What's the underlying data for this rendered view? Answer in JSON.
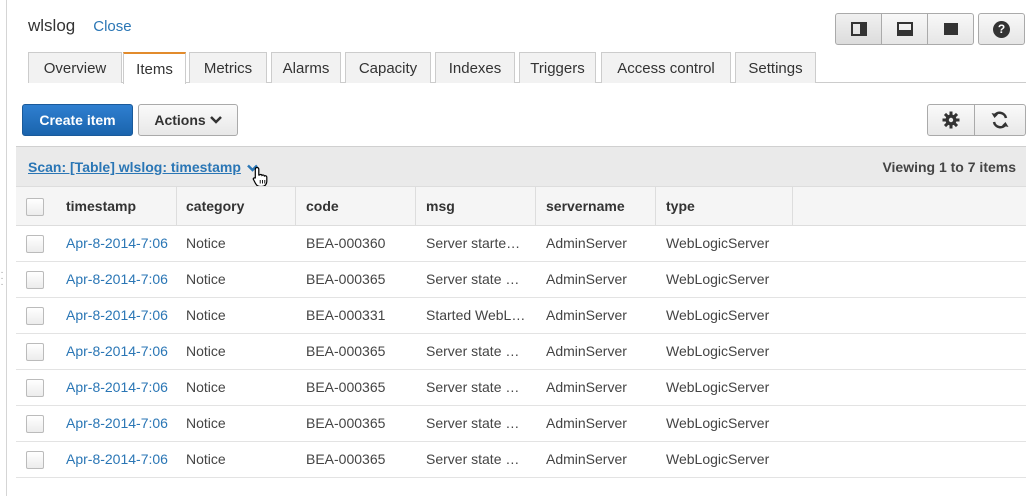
{
  "header": {
    "title": "wlslog",
    "close_label": "Close"
  },
  "view_toggles": [
    "split-vertical-icon",
    "split-horizontal-icon",
    "fullscreen-icon"
  ],
  "help_label": "?",
  "tabs": [
    {
      "label": "Overview"
    },
    {
      "label": "Items",
      "active": true
    },
    {
      "label": "Metrics"
    },
    {
      "label": "Alarms"
    },
    {
      "label": "Capacity"
    },
    {
      "label": "Indexes"
    },
    {
      "label": "Triggers"
    },
    {
      "label": "Access control"
    },
    {
      "label": "Settings"
    }
  ],
  "toolbar": {
    "create_label": "Create item",
    "actions_label": "Actions"
  },
  "scan": {
    "label": "Scan: [Table] wlslog: timestamp",
    "viewing": "Viewing 1 to 7 items"
  },
  "columns": [
    "timestamp",
    "category",
    "code",
    "msg",
    "servername",
    "type"
  ],
  "rows": [
    {
      "timestamp": "Apr-8-2014-7:06",
      "category": "Notice",
      "code": "BEA-000360",
      "msg": "Server started in RUNNING mode",
      "servername": "AdminServer",
      "type": "WebLogicServer"
    },
    {
      "timestamp": "Apr-8-2014-7:06",
      "category": "Notice",
      "code": "BEA-000365",
      "msg": "Server state changed",
      "servername": "AdminServer",
      "type": "WebLogicServer"
    },
    {
      "timestamp": "Apr-8-2014-7:06",
      "category": "Notice",
      "code": "BEA-000331",
      "msg": "Started WebLogic Admin Server",
      "servername": "AdminServer",
      "type": "WebLogicServer"
    },
    {
      "timestamp": "Apr-8-2014-7:06",
      "category": "Notice",
      "code": "BEA-000365",
      "msg": "Server state changed",
      "servername": "AdminServer",
      "type": "WebLogicServer"
    },
    {
      "timestamp": "Apr-8-2014-7:06",
      "category": "Notice",
      "code": "BEA-000365",
      "msg": "Server state changed",
      "servername": "AdminServer",
      "type": "WebLogicServer"
    },
    {
      "timestamp": "Apr-8-2014-7:06",
      "category": "Notice",
      "code": "BEA-000365",
      "msg": "Server state changed",
      "servername": "AdminServer",
      "type": "WebLogicServer"
    },
    {
      "timestamp": "Apr-8-2014-7:06",
      "category": "Notice",
      "code": "BEA-000365",
      "msg": "Server state changed",
      "servername": "AdminServer",
      "type": "WebLogicServer"
    }
  ]
}
